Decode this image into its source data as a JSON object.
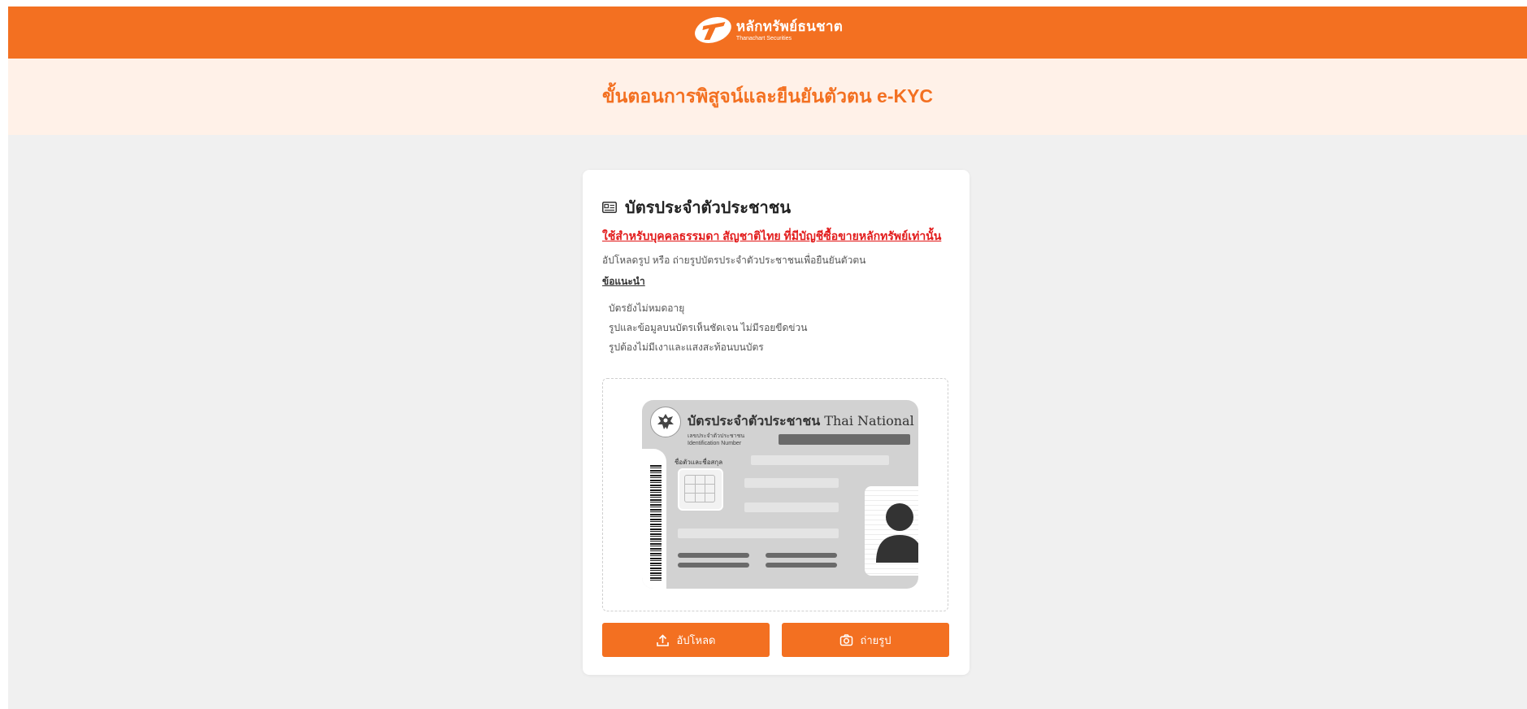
{
  "brand": {
    "name_th": "หลักทรัพย์ธนชาต",
    "name_en": "Thanachart Securities",
    "color": "#f37021"
  },
  "header": {
    "title": "ขั้นตอนการพิสูจน์และยืนยันตัวตน e-KYC"
  },
  "card": {
    "title": "บัตรประจำตัวประชาชน",
    "title_icon": "id-card-icon",
    "warning": "ใช้สำหรับบุคคลธรรมดา สัญชาติไทย ที่มีบัญชีซื้อขายหลักทรัพย์เท่านั้น",
    "description": "อัปโหลดรูป หรือ ถ่ายรูปบัตรประจำตัวประชาชนเพื่อยืนยันตัวตน",
    "tips_heading": "ข้อแนะนำ",
    "tips": [
      "บัตรยังไม่หมดอายุ",
      "รูปและข้อมูลบนบัตรเห็นชัดเจน ไม่มีรอยขีดข่วน",
      "รูปต้องไม่มีเงาและแสงสะท้อนบนบัตร"
    ]
  },
  "sample_card": {
    "title_th": "บัตรประจำตัวประชาชน",
    "title_en": "Thai National ID Card",
    "id_label_th": "เลขประจำตัวประชาชน",
    "id_label_en": "Identification Number",
    "name_label": "ชื่อตัวและชื่อสกุล"
  },
  "actions": {
    "upload_label": "อัปโหลด",
    "upload_icon": "upload-icon",
    "camera_label": "ถ่ายรูป",
    "camera_icon": "camera-icon"
  }
}
